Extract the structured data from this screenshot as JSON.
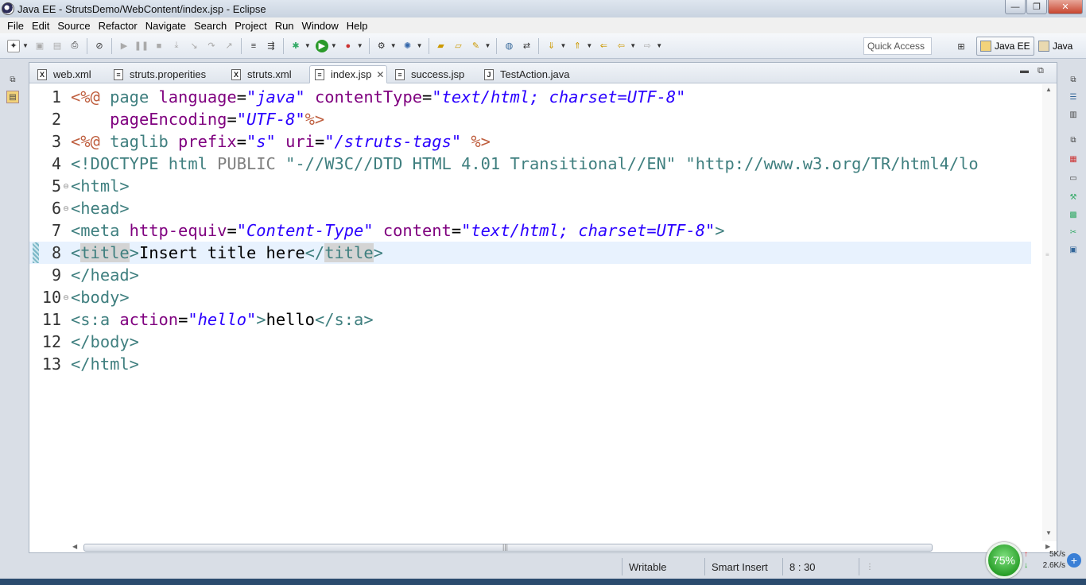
{
  "window": {
    "title": "Java EE - StrutsDemo/WebContent/index.jsp - Eclipse",
    "minimize": "—",
    "maximize": "❐",
    "close": "✕"
  },
  "menubar": [
    "File",
    "Edit",
    "Source",
    "Refactor",
    "Navigate",
    "Search",
    "Project",
    "Run",
    "Window",
    "Help"
  ],
  "toolbar": {
    "quick_access": "Quick Access",
    "perspectives": [
      "Java EE",
      "Java"
    ]
  },
  "tabs": [
    {
      "label": "web.xml",
      "icon": "x"
    },
    {
      "label": "struts.properities",
      "icon": "file"
    },
    {
      "label": "struts.xml",
      "icon": "x"
    },
    {
      "label": "index.jsp",
      "icon": "jsp",
      "active": true,
      "close": "✕"
    },
    {
      "label": "success.jsp",
      "icon": "jsp"
    },
    {
      "label": "TestAction.java",
      "icon": "J"
    }
  ],
  "editor": {
    "line_numbers": [
      "1",
      "2",
      "3",
      "4",
      "5",
      "6",
      "7",
      "8",
      "9",
      "10",
      "11",
      "12",
      "13"
    ],
    "current_line": 8,
    "lines": [
      [
        [
          "t-dir",
          "<%@ "
        ],
        [
          "t-kw",
          "page "
        ],
        [
          "t-attr",
          "language"
        ],
        [
          "t-text",
          "="
        ],
        [
          "t-str",
          "\"java\""
        ],
        [
          "t-text",
          " "
        ],
        [
          "t-attr",
          "contentType"
        ],
        [
          "t-text",
          "="
        ],
        [
          "t-str",
          "\"text/html; charset=UTF-8\""
        ]
      ],
      [
        [
          "t-text",
          "    "
        ],
        [
          "t-attr",
          "pageEncoding"
        ],
        [
          "t-text",
          "="
        ],
        [
          "t-str",
          "\"UTF-8\""
        ],
        [
          "t-dir",
          "%>"
        ]
      ],
      [
        [
          "t-dir",
          "<%@ "
        ],
        [
          "t-kw",
          "taglib "
        ],
        [
          "t-attr",
          "prefix"
        ],
        [
          "t-text",
          "="
        ],
        [
          "t-str",
          "\"s\""
        ],
        [
          "t-text",
          " "
        ],
        [
          "t-attr",
          "uri"
        ],
        [
          "t-text",
          "="
        ],
        [
          "t-str",
          "\"/struts-tags\""
        ],
        [
          "t-text",
          " "
        ],
        [
          "t-dir",
          "%>"
        ]
      ],
      [
        [
          "t-doc",
          "<!DOCTYPE "
        ],
        [
          "t-doc",
          "html "
        ],
        [
          "t-gray",
          "PUBLIC "
        ],
        [
          "t-docstr",
          "\"-//W3C//DTD HTML 4.01 Transitional//EN\" \"http://www.w3.org/TR/html4/lo"
        ]
      ],
      [
        [
          "t-tag",
          "<html>"
        ]
      ],
      [
        [
          "t-tag",
          "<head>"
        ]
      ],
      [
        [
          "t-tag",
          "<meta "
        ],
        [
          "t-attr",
          "http-equiv"
        ],
        [
          "t-text",
          "="
        ],
        [
          "t-str",
          "\"Content-Type\""
        ],
        [
          "t-text",
          " "
        ],
        [
          "t-attr",
          "content"
        ],
        [
          "t-text",
          "="
        ],
        [
          "t-str",
          "\"text/html; charset=UTF-8\""
        ],
        [
          "t-tag",
          ">"
        ]
      ],
      [
        [
          "t-tag",
          "<"
        ],
        [
          "t-tag t-hl",
          "title"
        ],
        [
          "t-tag",
          ">"
        ],
        [
          "t-text",
          "Insert title here"
        ],
        [
          "t-tag",
          "</"
        ],
        [
          "t-tag t-hl",
          "title"
        ],
        [
          "t-tag",
          ">"
        ]
      ],
      [
        [
          "t-tag",
          "</head>"
        ]
      ],
      [
        [
          "t-tag",
          "<body>"
        ]
      ],
      [
        [
          "t-tag",
          "<s:a "
        ],
        [
          "t-attr",
          "action"
        ],
        [
          "t-text",
          "="
        ],
        [
          "t-str",
          "\"hello\""
        ],
        [
          "t-tag",
          ">"
        ],
        [
          "t-text",
          "hello"
        ],
        [
          "t-tag",
          "</s:a>"
        ]
      ],
      [
        [
          "t-tag",
          "</body>"
        ]
      ],
      [
        [
          "t-tag",
          "</html>"
        ]
      ]
    ],
    "fold_lines": [
      "5",
      "6",
      "10"
    ]
  },
  "statusbar": {
    "writable": "Writable",
    "insert_mode": "Smart Insert",
    "position": "8 : 30"
  },
  "system": {
    "battery": "75%",
    "upload": "5K/s",
    "download": "2.6K/s",
    "plus": "+"
  }
}
